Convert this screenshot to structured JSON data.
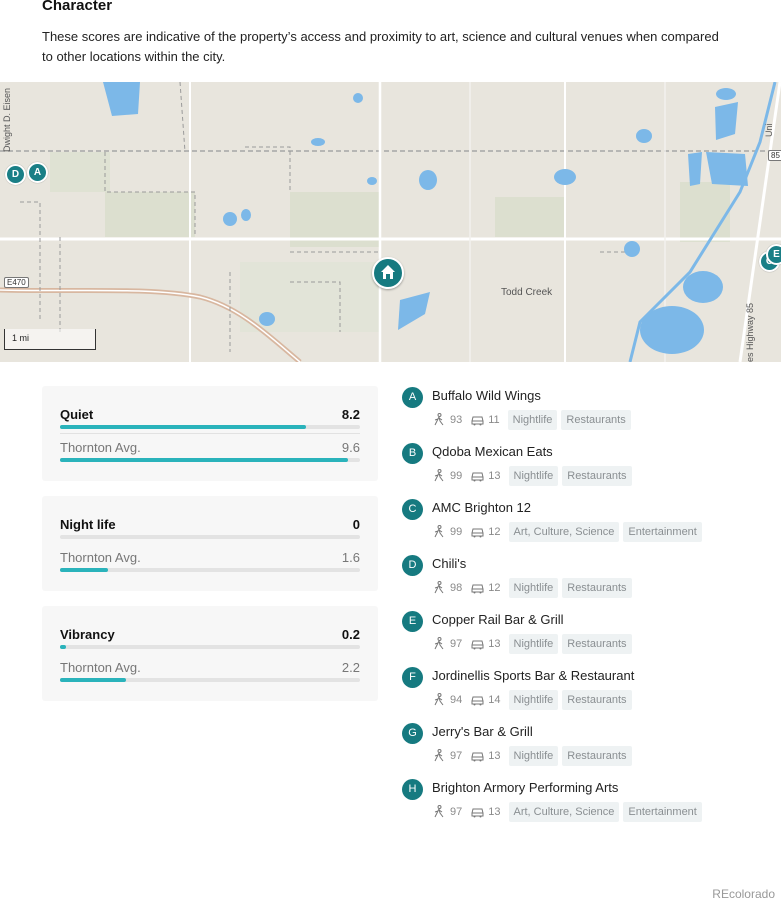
{
  "section": {
    "title": "Character",
    "description": "These scores are indicative of the property’s access and proximity to art, science and cultural venues when compared to other locations within the city."
  },
  "map": {
    "scale_label": "1 mi",
    "town_label": "Todd Creek",
    "highway_shield_left": "E470",
    "highway_shield_right": "85",
    "road_label_left": "Dwight D. Eisen",
    "road_label_right": "es Highway 85",
    "road_label_top_right": "Uni",
    "pins": [
      "D",
      "A",
      "C",
      "E"
    ]
  },
  "scores": [
    {
      "label": "Quiet",
      "value": "8.2",
      "fraction": 0.82,
      "avg_label": "Thornton Avg.",
      "avg_value": "9.6",
      "avg_fraction": 0.96
    },
    {
      "label": "Night life",
      "value": "0",
      "fraction": 0.0,
      "avg_label": "Thornton Avg.",
      "avg_value": "1.6",
      "avg_fraction": 0.16
    },
    {
      "label": "Vibrancy",
      "value": "0.2",
      "fraction": 0.02,
      "avg_label": "Thornton Avg.",
      "avg_value": "2.2",
      "avg_fraction": 0.22
    }
  ],
  "venues": [
    {
      "letter": "A",
      "name": "Buffalo Wild Wings",
      "walk": "93",
      "drive": "11",
      "tags": [
        "Nightlife",
        "Restaurants"
      ]
    },
    {
      "letter": "B",
      "name": "Qdoba Mexican Eats",
      "walk": "99",
      "drive": "13",
      "tags": [
        "Nightlife",
        "Restaurants"
      ]
    },
    {
      "letter": "C",
      "name": "AMC Brighton 12",
      "walk": "99",
      "drive": "12",
      "tags": [
        "Art, Culture, Science",
        "Entertainment"
      ]
    },
    {
      "letter": "D",
      "name": "Chili's",
      "walk": "98",
      "drive": "12",
      "tags": [
        "Nightlife",
        "Restaurants"
      ]
    },
    {
      "letter": "E",
      "name": "Copper Rail Bar & Grill",
      "walk": "97",
      "drive": "13",
      "tags": [
        "Nightlife",
        "Restaurants"
      ]
    },
    {
      "letter": "F",
      "name": "Jordinellis Sports Bar & Restaurant",
      "walk": "94",
      "drive": "14",
      "tags": [
        "Nightlife",
        "Restaurants"
      ]
    },
    {
      "letter": "G",
      "name": "Jerry's Bar & Grill",
      "walk": "97",
      "drive": "13",
      "tags": [
        "Nightlife",
        "Restaurants"
      ]
    },
    {
      "letter": "H",
      "name": "Brighton Armory Performing Arts",
      "walk": "97",
      "drive": "13",
      "tags": [
        "Art, Culture, Science",
        "Entertainment"
      ]
    }
  ],
  "icons": {
    "walk": "walk-icon",
    "drive": "car-icon",
    "home": "home-icon"
  },
  "colors": {
    "accent": "#167a80",
    "bar_fill": "#2ab3bb",
    "bar_track": "#e3e3e3",
    "water": "#7cb8e8"
  },
  "footer": {
    "brand": "REcolorado"
  }
}
